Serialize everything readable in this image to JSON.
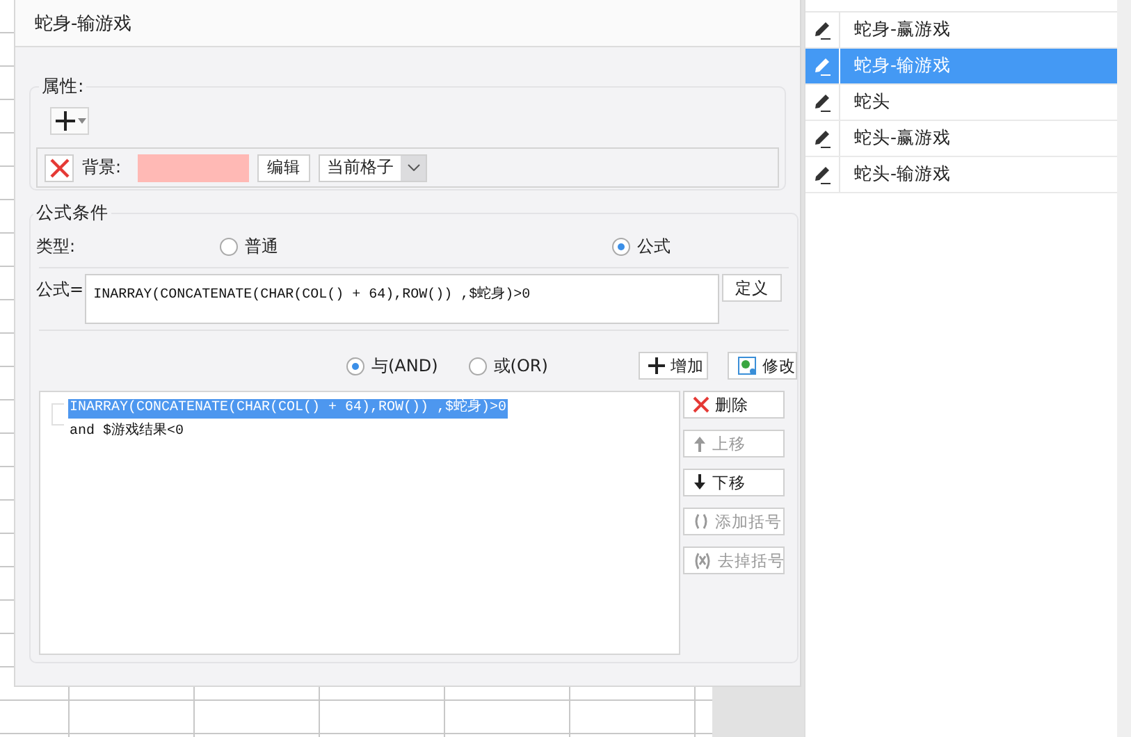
{
  "dialog": {
    "title": "蛇身-输游戏",
    "properties": {
      "legend": "属性:",
      "background_label": "背景:",
      "edit_button": "编辑",
      "scope_value": "当前格子"
    },
    "formula_condition": {
      "legend": "公式条件",
      "type_label": "类型:",
      "type_options": [
        {
          "label": "普通",
          "selected": false
        },
        {
          "label": "公式",
          "selected": true
        }
      ],
      "formula_label": "公式=",
      "formula_value": "INARRAY(CONCATENATE(CHAR(COL() + 64),ROW()) ,$蛇身)>0",
      "define_button": "定义",
      "join_options": [
        {
          "label": "与(AND)",
          "selected": true
        },
        {
          "label": "或(OR)",
          "selected": false
        }
      ],
      "add_button": "增加",
      "modify_button": "修改",
      "conditions": [
        {
          "text": "INARRAY(CONCATENATE(CHAR(COL() + 64),ROW()) ,$蛇身)>0",
          "selected": true
        },
        {
          "text": "and $游戏结果<0",
          "selected": false
        }
      ],
      "action_buttons": [
        {
          "kind": "delete",
          "label": "删除",
          "disabled": false
        },
        {
          "kind": "up",
          "label": "上移",
          "disabled": true
        },
        {
          "kind": "down",
          "label": "下移",
          "disabled": false
        },
        {
          "kind": "add_paren",
          "label": "添加括号",
          "disabled": true
        },
        {
          "kind": "remove_paren",
          "label": "去掉括号",
          "disabled": true
        }
      ]
    }
  },
  "side_list": {
    "items": [
      {
        "label": "蛇身-赢游戏",
        "selected": false
      },
      {
        "label": "蛇身-输游戏",
        "selected": true
      },
      {
        "label": "蛇头",
        "selected": false
      },
      {
        "label": "蛇头-赢游戏",
        "selected": false
      },
      {
        "label": "蛇头-输游戏",
        "selected": false
      }
    ]
  }
}
